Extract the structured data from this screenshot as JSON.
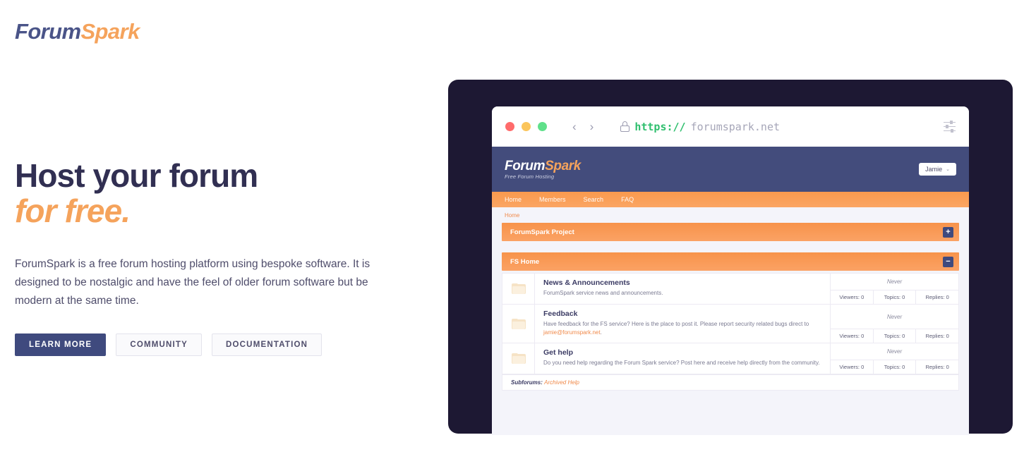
{
  "brand": {
    "part1": "Forum",
    "part2": "Spark"
  },
  "hero": {
    "heading_line1": "Host your forum",
    "heading_line2": "for free.",
    "paragraph": "ForumSpark is a free forum hosting platform using bespoke software. It is designed to be nostalgic and have the feel of older forum software but be modern at the same time.",
    "buttons": [
      {
        "label": "LEARN MORE",
        "style": "primary"
      },
      {
        "label": "COMMUNITY",
        "style": "ghost"
      },
      {
        "label": "DOCUMENTATION",
        "style": "ghost"
      }
    ]
  },
  "browser": {
    "url_protocol": "https://",
    "url_host": "forumspark.net",
    "back_glyph": "‹",
    "forward_glyph": "›",
    "traffic_lights": [
      "red",
      "yellow",
      "green"
    ]
  },
  "forum": {
    "logo": {
      "part1": "Forum",
      "part2": "Spark"
    },
    "tagline": "Free Forum Hosting",
    "user": {
      "name": "Jamie",
      "chevron": "⌄"
    },
    "nav": [
      "Home",
      "Members",
      "Search",
      "FAQ"
    ],
    "breadcrumb": "Home",
    "categories": [
      {
        "title": "ForumSpark Project",
        "toggle": "+"
      },
      {
        "title": "FS Home",
        "toggle": "−"
      }
    ],
    "boards": [
      {
        "title": "News & Announcements",
        "description": "ForumSpark service news and announcements.",
        "description_link": "",
        "description_tail": "",
        "last_post": "Never",
        "viewers": "Viewers: 0",
        "topics": "Topics: 0",
        "replies": "Replies: 0"
      },
      {
        "title": "Feedback",
        "description": "Have feedback for the FS service? Here is the place to post it. Please report security related bugs direct to ",
        "description_link": "jamie@forumspark.net",
        "description_tail": ".",
        "last_post": "Never",
        "viewers": "Viewers: 0",
        "topics": "Topics: 0",
        "replies": "Replies: 0"
      },
      {
        "title": "Get help",
        "description": "Do you need help regarding the Forum Spark service? Post here and receive help directly from the community.",
        "description_link": "",
        "description_tail": "",
        "last_post": "Never",
        "viewers": "Viewers: 0",
        "topics": "Topics: 0",
        "replies": "Replies: 0"
      }
    ],
    "subforums_label": "Subforums:",
    "subforums_link": "Archived Help"
  },
  "colors": {
    "navy": "#3f4a7e",
    "orange": "#f5a35c",
    "dark_frame": "#1d1833",
    "heading": "#312f52",
    "forum_header": "#434c7c",
    "url_green": "#2fbf6e"
  }
}
